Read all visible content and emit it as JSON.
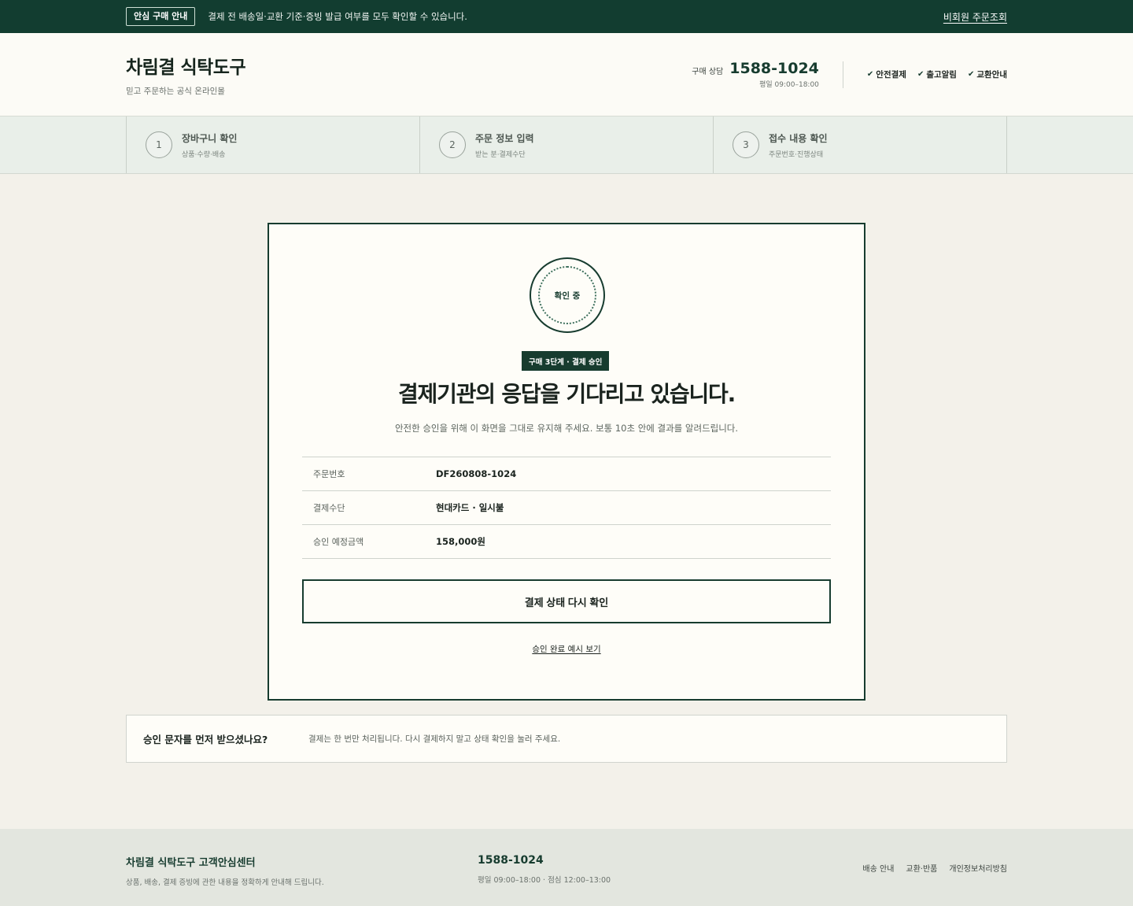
{
  "topbar": {
    "pill": "안심 구매 안내",
    "notice": "결제 전 배송일·교환 기준·증빙 발급 여부를 모두 확인할 수 있습니다.",
    "guest_link": "비회원 주문조회"
  },
  "header": {
    "brand_name": "차림결 식탁도구",
    "brand_tag": "믿고 주문하는 공식 온라인몰",
    "contact_label": "구매 상담",
    "phone": "1588-1024",
    "hours": "평일 09:00–18:00",
    "badges": [
      "안전결제",
      "출고알림",
      "교환안내"
    ]
  },
  "steps": [
    {
      "num": "1",
      "title": "장바구니 확인",
      "sub": "상품·수량·배송"
    },
    {
      "num": "2",
      "title": "주문 정보 입력",
      "sub": "받는 분·결제수단"
    },
    {
      "num": "3",
      "title": "접수 내용 확인",
      "sub": "주문번호·진행상태"
    }
  ],
  "card": {
    "seal_text": "확인 중",
    "stage_badge": "구매 3단계 · 결제 승인",
    "headline": "결제기관의 응답을 기다리고 있습니다.",
    "subline": "안전한 승인을 위해 이 화면을 그대로 유지해 주세요. 보통 10초 안에 결과를 알려드립니다.",
    "rows": [
      {
        "k": "주문번호",
        "v": "DF260808-1024"
      },
      {
        "k": "결제수단",
        "v": "현대카드 · 일시불"
      },
      {
        "k": "승인 예정금액",
        "v": "158,000원"
      }
    ],
    "recheck_button": "결제 상태 다시 확인",
    "example_link": "승인 완료 예시 보기"
  },
  "sms": {
    "question": "승인 문자를 먼저 받으셨나요?",
    "answer": "결제는 한 번만 처리됩니다. 다시 결제하지 말고 상태 확인을 눌러 주세요."
  },
  "footer": {
    "title": "차림결 식탁도구 고객안심센터",
    "desc": "상품, 배송, 결제 증빙에 관한 내용을 정확하게 안내해 드립니다.",
    "phone": "1588-1024",
    "hours": "평일 09:00–18:00 · 점심 12:00–13:00",
    "links": [
      "배송 안내",
      "교환·반품",
      "개인정보처리방침"
    ]
  }
}
